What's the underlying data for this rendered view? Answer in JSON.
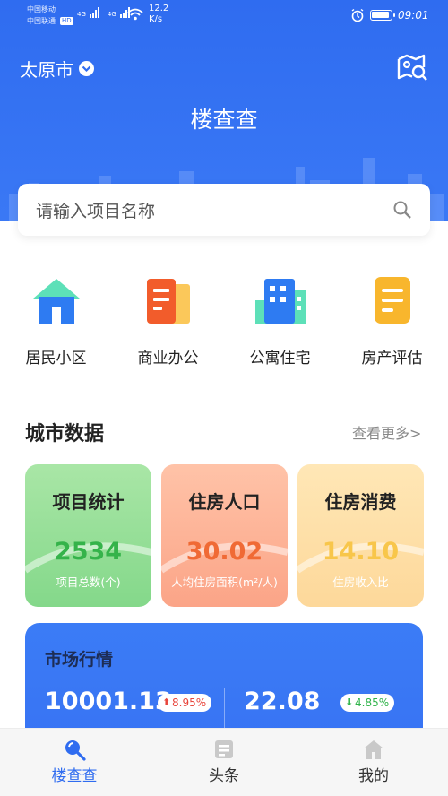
{
  "status_bar": {
    "carrier1": "中国移动",
    "carrier2": "中国联通",
    "hd": "HD",
    "net1": "4G",
    "net2": "4G",
    "speed_value": "12.2",
    "speed_unit": "K/s",
    "time": "09:01",
    "battery_level": 0.9
  },
  "header": {
    "city": "太原市",
    "app_title": "楼查查",
    "map_icon": "map-search-icon"
  },
  "search": {
    "placeholder": "请输入项目名称",
    "icon": "search-icon"
  },
  "categories": [
    {
      "label": "居民小区",
      "icon": "house-icon",
      "color": "#2e7bf2"
    },
    {
      "label": "商业办公",
      "icon": "office-building-icon",
      "color": "#f25c2b"
    },
    {
      "label": "公寓住宅",
      "icon": "apartment-icon",
      "color": "#2e7bf2"
    },
    {
      "label": "房产评估",
      "icon": "document-icon",
      "color": "#f8b62d"
    }
  ],
  "city_data": {
    "title": "城市数据",
    "more": "查看更多>",
    "cards": [
      {
        "title": "项目统计",
        "value": "2534",
        "subtitle": "项目总数(个)",
        "value_color": "#35b34a"
      },
      {
        "title": "住房人口",
        "value": "30.02",
        "subtitle": "人均住房面积(m²/人)",
        "value_color": "#f06a35"
      },
      {
        "title": "住房消费",
        "value": "14.10",
        "subtitle": "住房收入比",
        "value_color": "#f8c64a"
      }
    ]
  },
  "market": {
    "title": "市场行情",
    "items": [
      {
        "value": "10001.13",
        "change": "8.95%",
        "direction": "up",
        "color": "#e8453c"
      },
      {
        "value": "22.08",
        "change": "4.85%",
        "direction": "down",
        "color": "#2fb34a"
      }
    ]
  },
  "nav": {
    "items": [
      {
        "label": "楼查查",
        "icon": "search-icon",
        "active": true
      },
      {
        "label": "头条",
        "icon": "news-icon",
        "active": false
      },
      {
        "label": "我的",
        "icon": "home-icon",
        "active": false
      }
    ],
    "active_color": "#2f6cf0",
    "inactive_color": "#333333"
  }
}
